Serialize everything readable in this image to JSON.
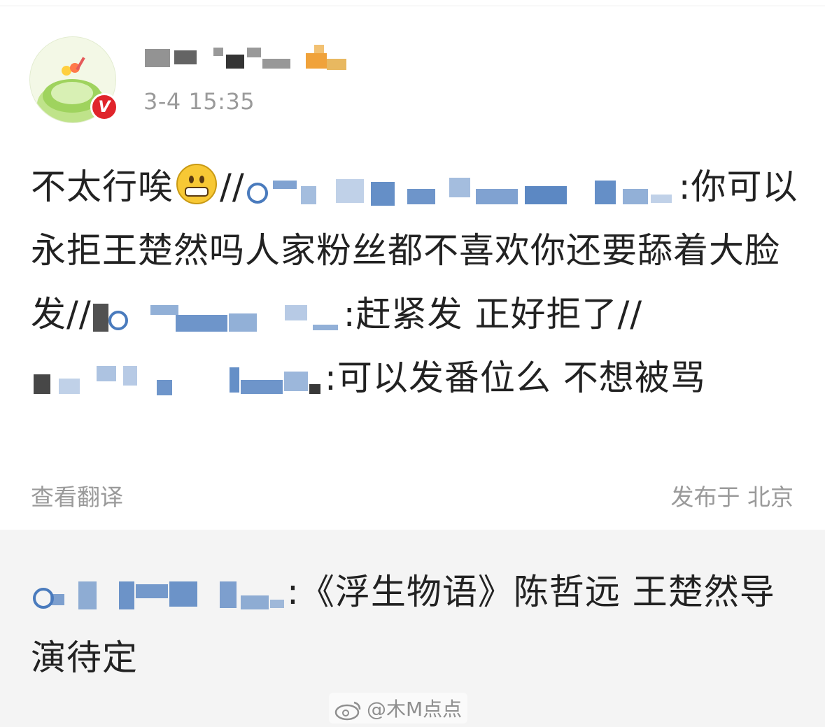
{
  "post": {
    "time": "3-4 15:35",
    "verify_badge": "V",
    "text": {
      "seg1": "不太行唉",
      "emoji": "grimacing-face",
      "sep1": "//",
      "seg2": ":你可以永拒王楚然吗人家粉丝都不喜欢你还要舔着大脸发",
      "sep2": "//",
      "seg3": ":赶紧发 正好拒了",
      "sep3": "//",
      "seg4": ":可以发番位么 不想被骂"
    },
    "translate_label": "查看翻译",
    "location_label": "发布于 北京"
  },
  "quoted": {
    "text": ":《浮生物语》陈哲远 王楚然导演待定"
  },
  "watermark": {
    "text": "@木M点点",
    "icon": "weibo-logo-icon"
  },
  "colors": {
    "mention_blue": "#4a7bbd",
    "meta_gray": "#9a9a9a",
    "verify_red": "#e0242b",
    "quoted_bg": "#f4f4f4"
  }
}
